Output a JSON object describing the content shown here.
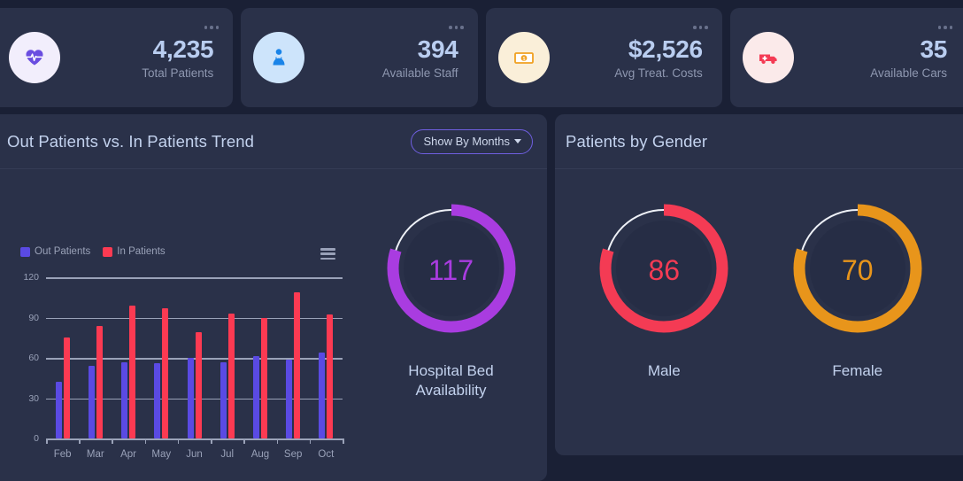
{
  "stat_cards": [
    {
      "id": "total-patients",
      "value": "4,235",
      "label": "Total Patients",
      "icon": "heartbeat-icon",
      "icon_color": "#6a4de0",
      "circle_color": "#f2eefc",
      "menu": "more-options"
    },
    {
      "id": "available-staff",
      "value": "394",
      "label": "Available Staff",
      "icon": "doctor-icon",
      "icon_color": "#1a84e8",
      "circle_color": "#cde4fb",
      "menu": "more-options"
    },
    {
      "id": "avg-treat-costs",
      "value": "$2,526",
      "label": "Avg Treat. Costs",
      "icon": "money-icon",
      "icon_color": "#f0a020",
      "circle_color": "#faefd9",
      "menu": "more-options"
    },
    {
      "id": "available-cars",
      "value": "35",
      "label": "Available Cars",
      "icon": "ambulance-icon",
      "icon_color": "#f43b54",
      "circle_color": "#fbeaea",
      "menu": "more-options"
    }
  ],
  "trend_panel": {
    "title": "Out Patients vs. In Patients Trend",
    "dropdown_label": "Show By Months",
    "menu_icon": "hamburger-menu-icon"
  },
  "gender_panel": {
    "title": "Patients by Gender"
  },
  "bed_donut": {
    "value": "117",
    "caption_line1": "Hospital Bed",
    "caption_line2": "Availability",
    "color": "#a93ce0",
    "percent": 80
  },
  "gender_donuts": [
    {
      "id": "male",
      "value": "86",
      "caption": "Male",
      "color": "#f43b54",
      "percent": 80
    },
    {
      "id": "female",
      "value": "70",
      "caption": "Female",
      "color": "#e8951b",
      "percent": 80
    }
  ],
  "colors": {
    "page_bg": "#1a2035",
    "card_bg": "#2a3149",
    "accent_purple": "#6f5fe0",
    "out_patients": "#5a4ae3",
    "in_patients": "#fc3a52"
  },
  "chart_data": {
    "type": "bar",
    "title": "Out Patients vs. In Patients Trend",
    "xlabel": "",
    "ylabel": "",
    "categories": [
      "Feb",
      "Mar",
      "Apr",
      "May",
      "Jun",
      "Jul",
      "Aug",
      "Sep",
      "Oct"
    ],
    "series": [
      {
        "name": "Out Patients",
        "color": "#5a4ae3",
        "values": [
          42,
          54,
          57,
          56,
          60,
          57,
          61,
          59,
          64
        ]
      },
      {
        "name": "In Patients",
        "color": "#fc3a52",
        "values": [
          75,
          84,
          99,
          97,
          79,
          93,
          90,
          109,
          92
        ]
      }
    ],
    "yticks": [
      0,
      30,
      60,
      90,
      120
    ],
    "ylim": [
      0,
      120
    ],
    "grid": true,
    "legend_position": "top-left"
  },
  "donut_chart_data": [
    {
      "type": "pie",
      "title": "Hospital Bed Availability",
      "value": 117,
      "filled_percent": 80,
      "color": "#a93ce0"
    },
    {
      "type": "pie",
      "title": "Male",
      "value": 86,
      "filled_percent": 80,
      "color": "#f43b54"
    },
    {
      "type": "pie",
      "title": "Female",
      "value": 70,
      "filled_percent": 80,
      "color": "#e8951b"
    }
  ]
}
